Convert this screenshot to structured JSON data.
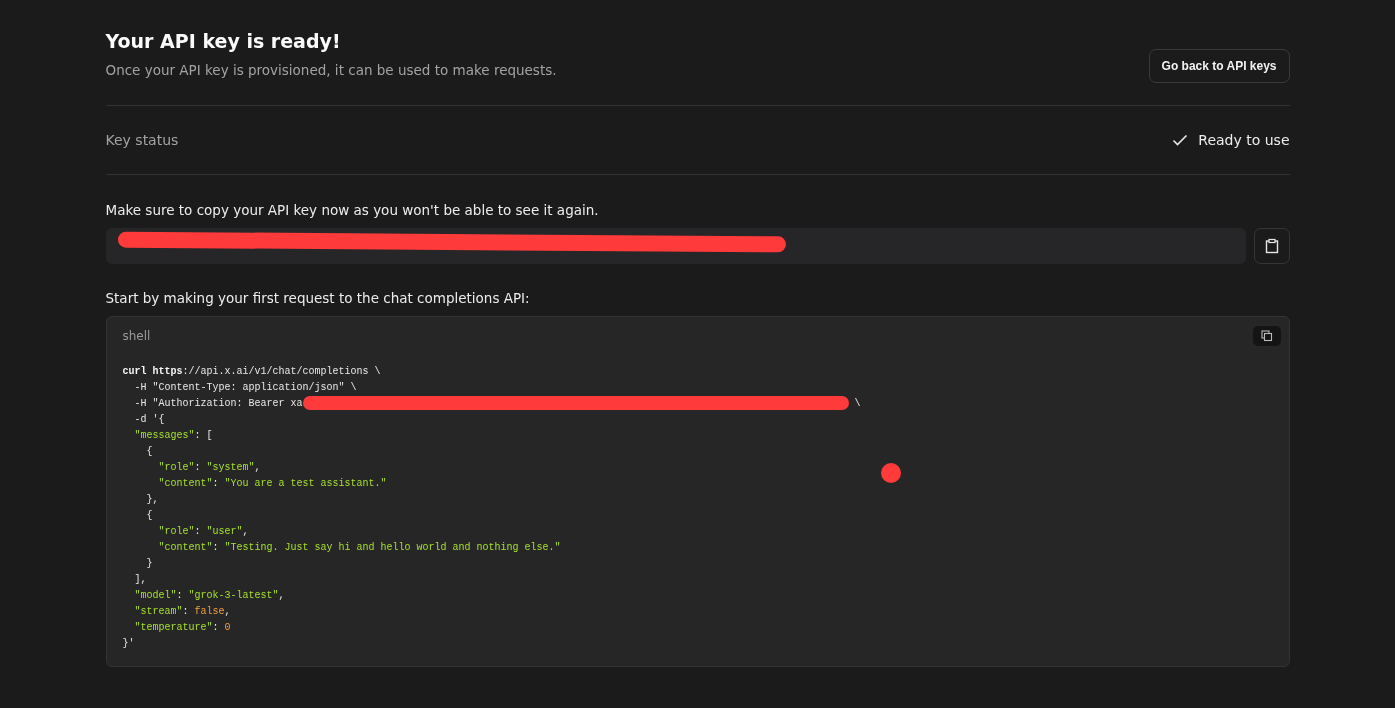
{
  "header": {
    "title": "Your API key is ready!",
    "subtitle": "Once your API key is provisioned, it can be used to make requests.",
    "back_button": "Go back to API keys"
  },
  "key_status": {
    "label": "Key status",
    "value": "Ready to use",
    "ready": true
  },
  "key_section": {
    "instruction": "Make sure to copy your API key now as you won't be able to see it again.",
    "redacted": true
  },
  "request_section": {
    "instruction": "Start by making your first request to the chat completions API:",
    "language": "shell",
    "lines": [
      [
        {
          "kind": "keyword",
          "text": "curl https"
        },
        {
          "kind": "plain",
          "text": "://api.x.ai/v1/chat/completions \\"
        }
      ],
      [
        {
          "kind": "plain",
          "text": "  -H \"Content-Type: application/json\" \\"
        }
      ],
      [
        {
          "kind": "plain",
          "text": "  -H \"Authorization: Bearer xa"
        },
        {
          "kind": "redaction"
        },
        {
          "kind": "plain",
          "text": " \\"
        }
      ],
      [
        {
          "kind": "plain",
          "text": "  -d '{"
        }
      ],
      [
        {
          "kind": "string",
          "text": "  \"messages\""
        },
        {
          "kind": "plain",
          "text": ": ["
        }
      ],
      [
        {
          "kind": "plain",
          "text": "    {"
        }
      ],
      [
        {
          "kind": "string",
          "text": "      \"role\""
        },
        {
          "kind": "plain",
          "text": ": "
        },
        {
          "kind": "string",
          "text": "\"system\""
        },
        {
          "kind": "plain",
          "text": ","
        }
      ],
      [
        {
          "kind": "string",
          "text": "      \"content\""
        },
        {
          "kind": "plain",
          "text": ": "
        },
        {
          "kind": "string",
          "text": "\"You are a test assistant.\""
        }
      ],
      [
        {
          "kind": "plain",
          "text": "    },"
        }
      ],
      [
        {
          "kind": "plain",
          "text": "    {"
        }
      ],
      [
        {
          "kind": "string",
          "text": "      \"role\""
        },
        {
          "kind": "plain",
          "text": ": "
        },
        {
          "kind": "string",
          "text": "\"user\""
        },
        {
          "kind": "plain",
          "text": ","
        }
      ],
      [
        {
          "kind": "string",
          "text": "      \"content\""
        },
        {
          "kind": "plain",
          "text": ": "
        },
        {
          "kind": "string",
          "text": "\"Testing. Just say hi and hello world and nothing else.\""
        }
      ],
      [
        {
          "kind": "plain",
          "text": "    }"
        }
      ],
      [
        {
          "kind": "plain",
          "text": "  ],"
        }
      ],
      [
        {
          "kind": "string",
          "text": "  \"model\""
        },
        {
          "kind": "plain",
          "text": ": "
        },
        {
          "kind": "string",
          "text": "\"grok-3-latest\""
        },
        {
          "kind": "plain",
          "text": ","
        }
      ],
      [
        {
          "kind": "string",
          "text": "  \"stream\""
        },
        {
          "kind": "plain",
          "text": ": "
        },
        {
          "kind": "literal",
          "text": "false"
        },
        {
          "kind": "plain",
          "text": ","
        }
      ],
      [
        {
          "kind": "string",
          "text": "  \"temperature\""
        },
        {
          "kind": "plain",
          "text": ": "
        },
        {
          "kind": "literal",
          "text": "0"
        }
      ],
      [
        {
          "kind": "plain",
          "text": "}'"
        }
      ]
    ]
  }
}
